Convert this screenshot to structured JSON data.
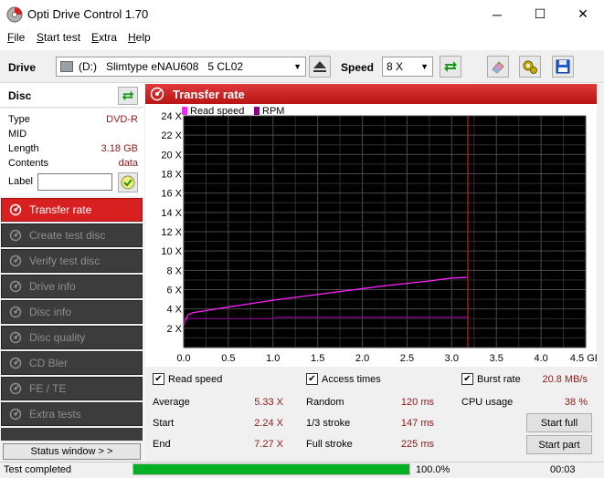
{
  "window": {
    "title": "Opti Drive Control 1.70",
    "minimize": "─",
    "maximize": "☐",
    "close": "✕"
  },
  "menu": [
    {
      "label": "File",
      "accel": "F"
    },
    {
      "label": "Start test",
      "accel": "S"
    },
    {
      "label": "Extra",
      "accel": "E"
    },
    {
      "label": "Help",
      "accel": "H"
    }
  ],
  "toolbar": {
    "drive_label": "Drive",
    "drive_letter": "(D:)",
    "drive_name": "Slimtype eNAU608   5 CL02",
    "speed_label": "Speed",
    "speed_value": "8 X"
  },
  "disc": {
    "title": "Disc",
    "rows": [
      {
        "label": "Type",
        "value": "DVD-R"
      },
      {
        "label": "MID",
        "value": ""
      },
      {
        "label": "Length",
        "value": "3.18 GB"
      },
      {
        "label": "Contents",
        "value": "data"
      }
    ],
    "label_field": "Label",
    "label_value": ""
  },
  "nav": [
    {
      "label": "Transfer rate",
      "active": true
    },
    {
      "label": "Create test disc",
      "active": false
    },
    {
      "label": "Verify test disc",
      "active": false
    },
    {
      "label": "Drive info",
      "active": false
    },
    {
      "label": "Disc info",
      "active": false
    },
    {
      "label": "Disc quality",
      "active": false
    },
    {
      "label": "CD Bler",
      "active": false
    },
    {
      "label": "FE / TE",
      "active": false
    },
    {
      "label": "Extra tests",
      "active": false
    }
  ],
  "status_window_button": "Status window > >",
  "panel_title": "Transfer rate",
  "chart_data": {
    "type": "line",
    "legend": [
      "Read speed",
      "RPM"
    ],
    "legend_colors": [
      "#ff22ff",
      "#8b008b"
    ],
    "xlim": [
      0,
      4.5
    ],
    "ylim": [
      0,
      24
    ],
    "x_ticks": [
      "0.0",
      "0.5",
      "1.0",
      "1.5",
      "2.0",
      "2.5",
      "3.0",
      "3.5",
      "4.0",
      "4.5 GB"
    ],
    "y_ticks": [
      "2 X",
      "4 X",
      "6 X",
      "8 X",
      "10 X",
      "12 X",
      "14 X",
      "16 X",
      "18 X",
      "20 X",
      "22 X",
      "24 X"
    ],
    "marker_x": 3.18,
    "series": [
      {
        "name": "Read speed",
        "color": "#ff22ff",
        "x": [
          0,
          0.02,
          0.05,
          0.1,
          0.3,
          0.5,
          0.75,
          1.0,
          1.25,
          1.5,
          1.75,
          2.0,
          2.25,
          2.5,
          2.75,
          3.0,
          3.18
        ],
        "y": [
          2.2,
          2.9,
          3.4,
          3.6,
          3.9,
          4.2,
          4.55,
          4.9,
          5.2,
          5.5,
          5.8,
          6.1,
          6.4,
          6.65,
          6.9,
          7.2,
          7.27
        ]
      },
      {
        "name": "RPM",
        "color": "#8b008b",
        "x": [
          0,
          0.02,
          0.05,
          0.1,
          1.0,
          1.05,
          1.1,
          3.18
        ],
        "y": [
          2.2,
          2.8,
          3.0,
          3.0,
          3.0,
          3.15,
          3.15,
          3.15
        ]
      }
    ]
  },
  "checks": {
    "read_speed": "Read speed",
    "access_times": "Access times",
    "burst_rate": "Burst rate",
    "burst_rate_value": "20.8 MB/s"
  },
  "stats": {
    "average_label": "Average",
    "average": "5.33 X",
    "start_label": "Start",
    "start": "2.24 X",
    "end_label": "End",
    "end": "7.27 X",
    "random_label": "Random",
    "random": "120 ms",
    "third_label": "1/3 stroke",
    "third": "147 ms",
    "full_label": "Full stroke",
    "full": "225 ms",
    "cpu_label": "CPU usage",
    "cpu": "38 %"
  },
  "buttons": {
    "start_full": "Start full",
    "start_part": "Start part"
  },
  "status": {
    "text": "Test completed",
    "progress": 1.0,
    "progress_text": "100.0%",
    "time": "00:03"
  },
  "colors": {
    "accent": "#d92020",
    "progress": "#06b025"
  }
}
